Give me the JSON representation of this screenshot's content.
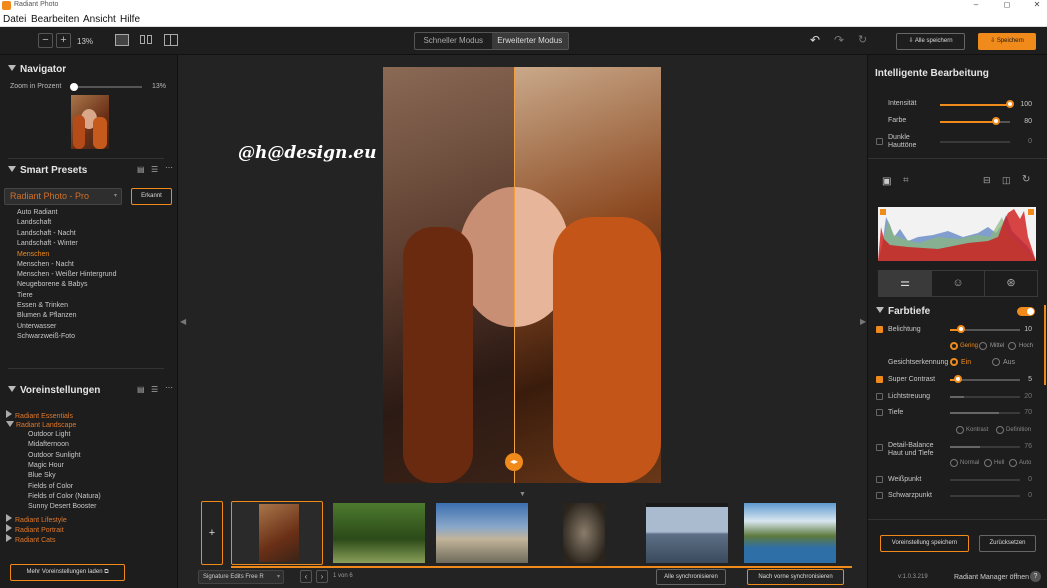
{
  "app": {
    "title": "Radiant Photo"
  },
  "menu": [
    "Datei",
    "Bearbeiten",
    "Ansicht",
    "Hilfe"
  ],
  "toolbar": {
    "zoom": "13%",
    "mode_simple": "Schneller Modus",
    "mode_advanced": "Erweiterter Modus",
    "save_all": "Alle speichern",
    "save": "Speichern"
  },
  "navigator": {
    "title": "Navigator",
    "zoom_label": "Zoom in Prozent",
    "zoom_value": "13%"
  },
  "smart_presets": {
    "title": "Smart Presets",
    "selected": "Radiant Photo - Pro",
    "detected": "Erkannt",
    "items": [
      "Auto Radiant",
      "Landschaft",
      "Landschaft - Nacht",
      "Landschaft - Winter",
      "Menschen",
      "Menschen - Nacht",
      "Menschen - Weißer Hintergrund",
      "Neugeborene & Babys",
      "Tiere",
      "Essen & Trinken",
      "Blumen & Pflanzen",
      "Unterwasser",
      "Schwarzweiß-Foto"
    ],
    "active_index": 4
  },
  "voreinstellungen": {
    "title": "Voreinstellungen",
    "groups": [
      {
        "label": "Radiant Essentials",
        "open": false
      },
      {
        "label": "Radiant Landscape",
        "open": true,
        "children": [
          "Outdoor Light",
          "Midafternoon",
          "Outdoor Sunlight",
          "Magic Hour",
          "Blue Sky",
          "Fields of Color",
          "Fields of Color (Natura)",
          "Sunny Desert Booster"
        ]
      },
      {
        "label": "Radiant Lifestyle",
        "open": false
      },
      {
        "label": "Radiant Portrait",
        "open": false
      },
      {
        "label": "Radiant Cats",
        "open": false
      }
    ],
    "more_button": "Mehr Voreinstellungen laden"
  },
  "watermark": "@h@design.eu",
  "filmstrip": {
    "add": "+",
    "preset_select": "Signature Edits Free R",
    "page": "1 von 6",
    "sync_all": "Alle synchronisieren",
    "sync_previous": "Nach vorne synchronisieren"
  },
  "right": {
    "title": "Intelligente Bearbeitung",
    "intensity": {
      "label": "Intensität",
      "value": "100",
      "level": 1.0
    },
    "color": {
      "label": "Farbe",
      "value": "80",
      "level": 0.8
    },
    "dark_skin": {
      "label1": "Dunkle",
      "label2": "Hauttöne",
      "value": "0"
    },
    "farbtiefe": "Farbtiefe",
    "belichtung": {
      "label": "Belichtung",
      "value": "10",
      "level": 0.15
    },
    "exposure_opts": [
      "Gering",
      "Mittel",
      "Hoch"
    ],
    "face": {
      "label": "Gesichtserkennung",
      "on": "Ein",
      "off": "Aus"
    },
    "super_contrast": {
      "label": "Super Contrast",
      "value": "5",
      "level": 0.12
    },
    "lichtstreuung": {
      "label": "Lichtstreuung",
      "value": "20"
    },
    "tiefe": {
      "label": "Tiefe",
      "value": "70"
    },
    "tiefe_opts": [
      "Kontrast",
      "Definition"
    ],
    "detail": {
      "label1": "Detail-Balance",
      "label2": "Haut und Tiefe",
      "value": "76"
    },
    "detail_opts": [
      "Normal",
      "Hell",
      "Auto"
    ],
    "weisspunkt": {
      "label": "Weißpunkt",
      "value": "0"
    },
    "schwarzpunkt": {
      "label": "Schwarzpunkt",
      "value": "0"
    },
    "save_preset": "Voreinstellung speichern",
    "reset": "Zurücksetzen"
  },
  "status": {
    "version": "v:1.0.3.219",
    "manager": "Radiant Manager öffnen"
  },
  "colors": {
    "accent": "#f08a1a"
  }
}
